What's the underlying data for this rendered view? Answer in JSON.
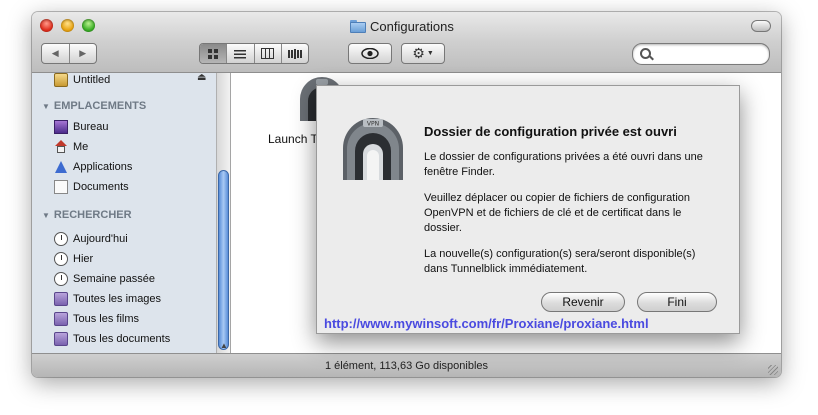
{
  "window": {
    "title": "Configurations"
  },
  "sidebar": {
    "devices": [
      {
        "label": "Untitled",
        "icon": "drive-icon"
      }
    ],
    "places_header": "EMPLACEMENTS",
    "places": [
      {
        "label": "Bureau",
        "icon": "desktop-icon"
      },
      {
        "label": "Me",
        "icon": "home-icon"
      },
      {
        "label": "Applications",
        "icon": "applications-icon"
      },
      {
        "label": "Documents",
        "icon": "documents-icon"
      }
    ],
    "search_header": "RECHERCHER",
    "searches": [
      {
        "label": "Aujourd'hui",
        "icon": "clock-icon"
      },
      {
        "label": "Hier",
        "icon": "clock-icon"
      },
      {
        "label": "Semaine passée",
        "icon": "clock-icon"
      },
      {
        "label": "Toutes les images",
        "icon": "smart-folder-icon"
      },
      {
        "label": "Tous les films",
        "icon": "smart-folder-icon"
      },
      {
        "label": "Tous les documents",
        "icon": "smart-folder-icon"
      }
    ]
  },
  "content": {
    "file_label": "Launch T"
  },
  "status": {
    "text": "1 élément, 113,63 Go disponibles"
  },
  "dialog": {
    "title": "Dossier de configuration privée est ouvri",
    "p1": "Le dossier de configurations privées a été ouvri dans une fenêtre Finder.",
    "p2": "Veuillez déplacer ou copier de fichiers de configuration OpenVPN et de fichiers de clé et de certificat dans le dossier.",
    "p3": "La nouvelle(s) configuration(s) sera/seront disponible(s) dans Tunnelblick immédiatement.",
    "revenir_label": "Revenir",
    "fini_label": "Fini",
    "icon_text": "VPN"
  },
  "watermark": {
    "text": "http://www.mywinsoft.com/fr/Proxiane/proxiane.html"
  },
  "colors": {
    "sidebar_bg": "#dde4ec",
    "link": "#4a4ae0",
    "scroll_thumb": "#5a8ed8"
  }
}
